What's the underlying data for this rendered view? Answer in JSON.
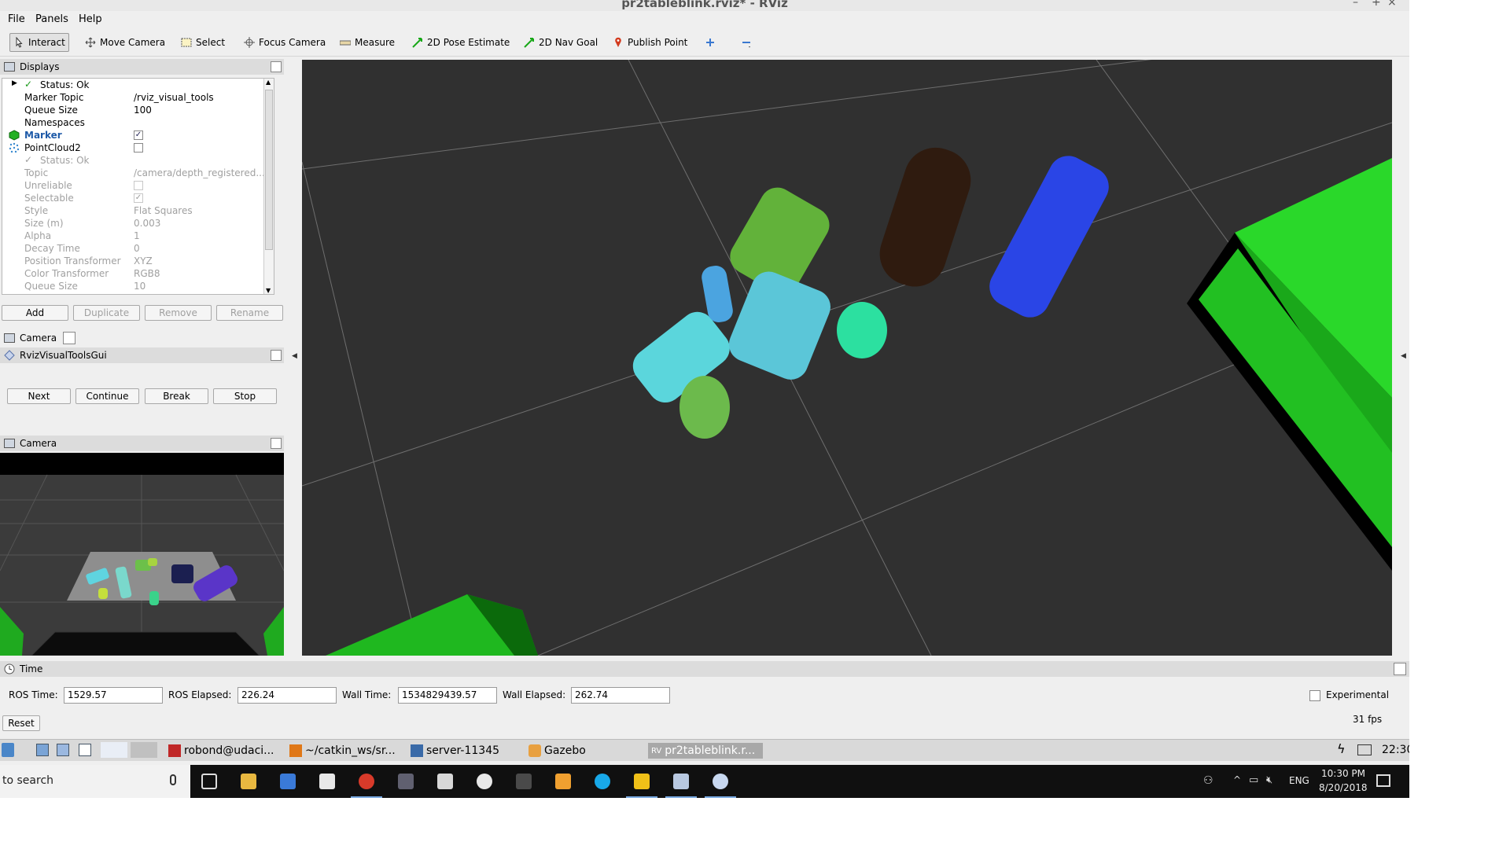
{
  "window": {
    "title": "pr2tableblink.rviz* - RViz",
    "minimize": "–",
    "maximize": "+",
    "close": "×"
  },
  "menu": [
    "File",
    "Panels",
    "Help"
  ],
  "toolbar": [
    {
      "label": "Interact",
      "icon": "cursor-icon"
    },
    {
      "label": "Move Camera",
      "icon": "move-camera-icon"
    },
    {
      "label": "Select",
      "icon": "select-box-icon"
    },
    {
      "label": "Focus Camera",
      "icon": "focus-camera-icon"
    },
    {
      "label": "Measure",
      "icon": "ruler-icon"
    },
    {
      "label": "2D Pose Estimate",
      "icon": "green-arrow-icon"
    },
    {
      "label": "2D Nav Goal",
      "icon": "green-arrow-icon"
    },
    {
      "label": "Publish Point",
      "icon": "map-pin-icon"
    }
  ],
  "displays": {
    "title": "Displays",
    "rows": [
      {
        "k": "Status: Ok",
        "v": ""
      },
      {
        "k": "Marker Topic",
        "v": "/rviz_visual_tools"
      },
      {
        "k": "Queue Size",
        "v": "100"
      },
      {
        "k": "Namespaces",
        "v": ""
      },
      {
        "k": "Marker",
        "v": ""
      },
      {
        "k": "PointCloud2",
        "v": ""
      },
      {
        "k": "Status: Ok",
        "v": ""
      },
      {
        "k": "Topic",
        "v": "/camera/depth_registered..."
      },
      {
        "k": "Unreliable",
        "v": ""
      },
      {
        "k": "Selectable",
        "v": ""
      },
      {
        "k": "Style",
        "v": "Flat Squares"
      },
      {
        "k": "Size (m)",
        "v": "0.003"
      },
      {
        "k": "Alpha",
        "v": "1"
      },
      {
        "k": "Decay Time",
        "v": "0"
      },
      {
        "k": "Position Transformer",
        "v": "XYZ"
      },
      {
        "k": "Color Transformer",
        "v": "RGB8"
      },
      {
        "k": "Queue Size",
        "v": "10"
      }
    ],
    "checkmark": "✓",
    "buttons": {
      "add": "Add",
      "duplicate": "Duplicate",
      "remove": "Remove",
      "rename": "Rename"
    }
  },
  "panels": {
    "camera_tool": "Camera",
    "visual_tools_gui": "RvizVisualToolsGui",
    "gui_buttons": {
      "next": "Next",
      "continue": "Continue",
      "break": "Break",
      "stop": "Stop"
    },
    "camera_view": "Camera"
  },
  "time": {
    "title": "Time",
    "ros_time_label": "ROS Time:",
    "ros_time": "1529.57",
    "ros_elapsed_label": "ROS Elapsed:",
    "ros_elapsed": "226.24",
    "wall_time_label": "Wall Time:",
    "wall_time": "1534829439.57",
    "wall_elapsed_label": "Wall Elapsed:",
    "wall_elapsed": "262.74",
    "experimental": "Experimental",
    "reset": "Reset",
    "fps": "31 fps"
  },
  "ubuntu_taskbar": {
    "items": [
      "robond@udaci...",
      "~/catkin_ws/sr...",
      "server-11345",
      "Gazebo",
      "pr2tableblink.r..."
    ],
    "clock": "22:30"
  },
  "windows_taskbar": {
    "search": "to search",
    "lang": "ENG",
    "time": "10:30 PM",
    "date": "8/20/2018"
  },
  "colors": {
    "marker_label": "#1e5aa8",
    "viewport_bg": "#303030",
    "grid": "#6e6e6e",
    "table_green": "#22c322"
  }
}
